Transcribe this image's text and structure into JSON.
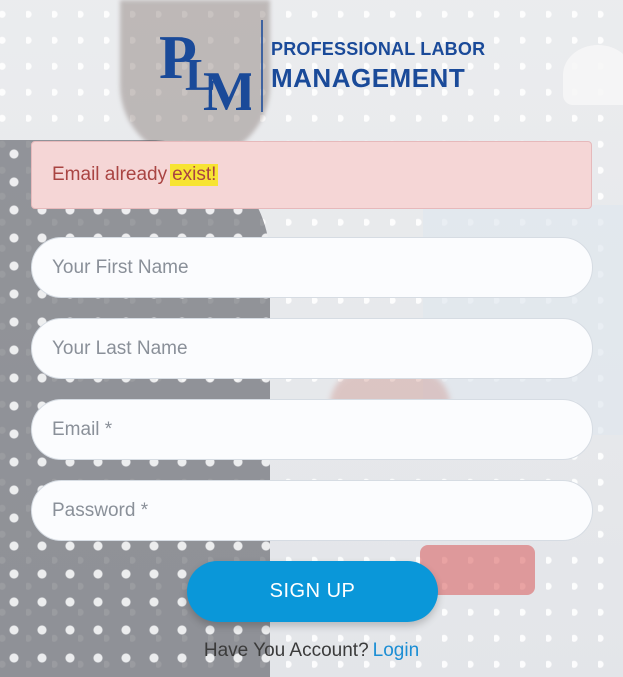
{
  "brand": {
    "monogram": "PLM",
    "line1": "PROFESSIONAL LABOR",
    "line2": "MANAGEMENT",
    "color": "#1a4a99"
  },
  "alert": {
    "text_before": "Email already",
    "text_highlight": "exist!",
    "bg_color": "#f5d6d6",
    "text_color": "#a94442",
    "highlight_color": "#f7e433"
  },
  "form": {
    "first_name": {
      "placeholder": "Your First Name",
      "value": ""
    },
    "last_name": {
      "placeholder": "Your Last Name",
      "value": ""
    },
    "email": {
      "placeholder": "Email *",
      "value": ""
    },
    "password": {
      "placeholder": "Password *",
      "value": ""
    },
    "submit_label": "SIGN UP",
    "submit_color": "#0a97d9"
  },
  "footer": {
    "prompt": "Have You Account?",
    "login_label": "Login",
    "link_color": "#1b8ed4"
  }
}
